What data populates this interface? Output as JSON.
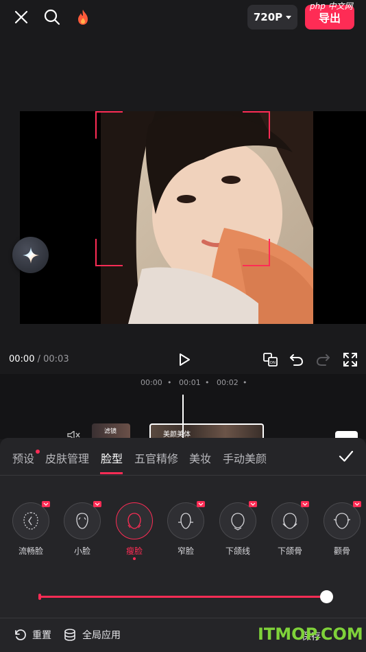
{
  "header": {
    "resolution_label": "720P",
    "export_label": "导出",
    "watermark": "php 中文网"
  },
  "player": {
    "current_time": "00:00",
    "separator": " / ",
    "duration": "00:03"
  },
  "timeline": {
    "ticks": [
      "00:00",
      "•",
      "00:01",
      "•",
      "00:02",
      "•"
    ],
    "clip_label": "美颜美体",
    "small_clip_label": "滤镜"
  },
  "tabs": [
    "预设",
    "皮肤管理",
    "脸型",
    "五官精修",
    "美妆",
    "手动美颜"
  ],
  "active_tab": "脸型",
  "options": [
    {
      "label": "流畅脸"
    },
    {
      "label": "小脸"
    },
    {
      "label": "瘦脸"
    },
    {
      "label": "窄脸"
    },
    {
      "label": "下颌线"
    },
    {
      "label": "下颌骨"
    },
    {
      "label": "颧骨"
    }
  ],
  "selected_option": "瘦脸",
  "slider": {
    "value": 1.0
  },
  "bottom": {
    "reset_label": "重置",
    "apply_all_label": "全局应用",
    "save_label": "保存",
    "watermark": "ITMOP.COM"
  },
  "colors": {
    "accent": "#fe2c55",
    "background": "#1a1a1c",
    "panel": "#252528"
  }
}
